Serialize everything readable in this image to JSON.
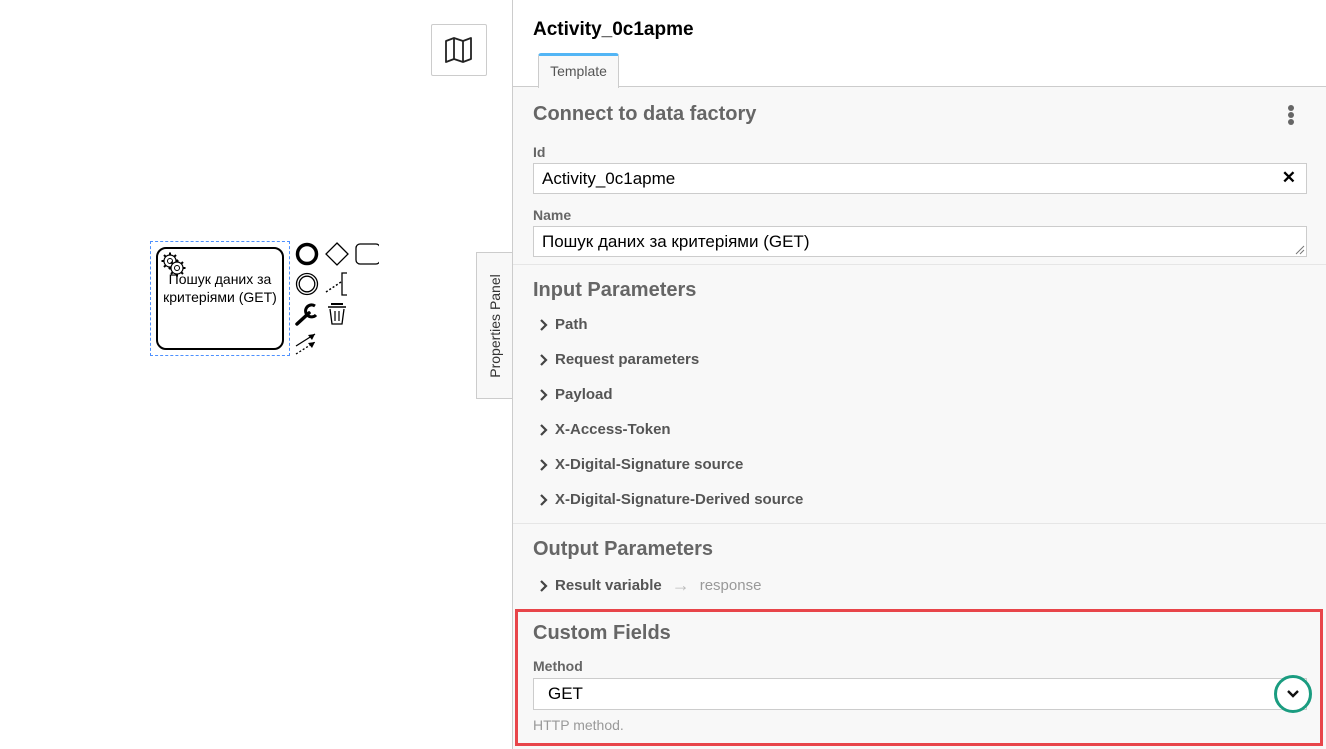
{
  "canvas": {
    "minimap_icon": "map-icon",
    "task": {
      "label": "Пошук даних за критеріями (GET)",
      "type_icon": "gear-icon"
    },
    "context_pad": [
      {
        "name": "append-end-event",
        "icon": "end-event-icon"
      },
      {
        "name": "append-gateway",
        "icon": "gateway-icon"
      },
      {
        "name": "append-task",
        "icon": "task-icon"
      },
      {
        "name": "append-intermediate-event",
        "icon": "intermediate-event-icon"
      },
      {
        "name": "append-text-annotation",
        "icon": "text-annotation-icon"
      },
      {
        "name": "change-type",
        "icon": "wrench-icon"
      },
      {
        "name": "delete",
        "icon": "trash-icon"
      },
      {
        "name": "connect",
        "icon": "connect-icon"
      }
    ]
  },
  "properties_toggle": {
    "label": "Properties Panel"
  },
  "panel": {
    "title": "Activity_0c1apme",
    "tabs": [
      {
        "label": "Template",
        "active": true
      }
    ],
    "template_group": {
      "title": "Connect to data factory",
      "id_label": "Id",
      "id_value": "Activity_0c1apme",
      "name_label": "Name",
      "name_value": "Пошук даних за критеріями (GET)"
    },
    "input_parameters": {
      "title": "Input Parameters",
      "items": [
        "Path",
        "Request parameters",
        "Payload",
        "X-Access-Token",
        "X-Digital-Signature source",
        "X-Digital-Signature-Derived source"
      ]
    },
    "output_parameters": {
      "title": "Output Parameters",
      "items": [
        {
          "label": "Result variable",
          "value": "response"
        }
      ]
    },
    "custom_fields": {
      "title": "Custom Fields",
      "method_label": "Method",
      "method_value": "GET",
      "method_hint": "HTTP method."
    }
  },
  "colors": {
    "highlight_box": "#e8454a",
    "focus_ring": "#1a9c80",
    "active_tab": "#52b5f5",
    "selection": "#4d90fe"
  }
}
